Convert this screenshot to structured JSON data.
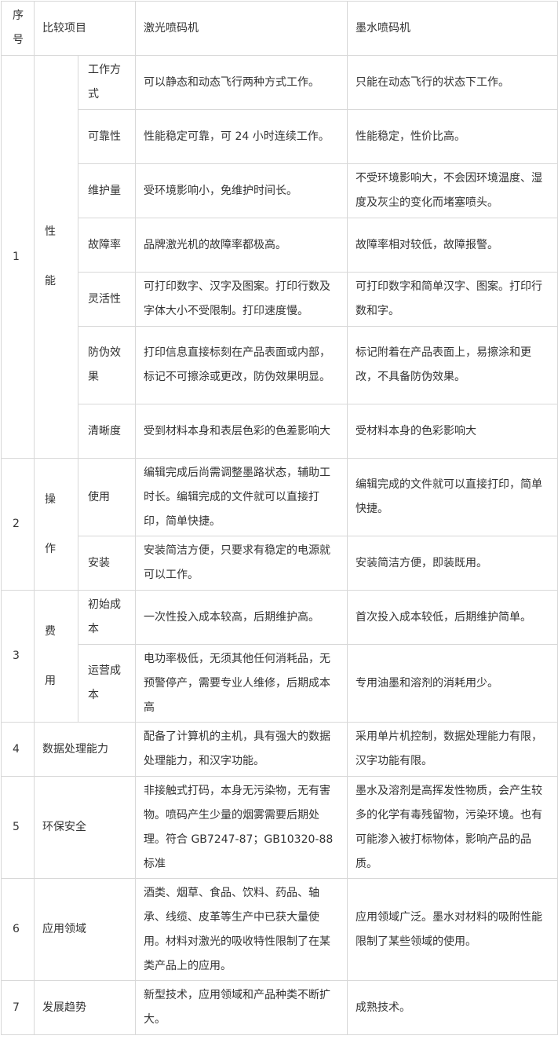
{
  "header": {
    "index": "序号",
    "item": "比较项目",
    "laser": "激光喷码机",
    "ink": "墨水喷码机"
  },
  "groups": {
    "performance": {
      "index": "1",
      "cat_top": "性",
      "cat_bottom": "能"
    },
    "operation": {
      "index": "2",
      "cat_top": "操",
      "cat_bottom": "作"
    },
    "cost": {
      "index": "3",
      "cat_top": "费",
      "cat_bottom": "用"
    }
  },
  "rows": [
    {
      "sub": "工作方式",
      "laser": "可以静态和动态飞行两种方式工作。",
      "ink": "只能在动态飞行的状态下工作。"
    },
    {
      "sub": "可靠性",
      "laser": "性能稳定可靠，可 24 小时连续工作。",
      "ink": "性能稳定，性价比高。"
    },
    {
      "sub": "维护量",
      "laser": "受环境影响小，免维护时间长。",
      "ink": "不受环境影响大，不会因环境温度、湿度及灰尘的变化而堵塞喷头。"
    },
    {
      "sub": "故障率",
      "laser": "品牌激光机的故障率都极高。",
      "ink": "故障率相对较低，故障报警。"
    },
    {
      "sub": "灵活性",
      "laser": "可打印数字、汉字及图案。打印行数及字体大小不受限制。打印速度慢。",
      "ink": "可打印数字和简单汉字、图案。打印行数和字。"
    },
    {
      "sub": "防伪效果",
      "laser": "打印信息直接标刻在产品表面或内部，标记不可擦涂或更改，防伪效果明显。",
      "ink": "标记附着在产品表面上，易擦涂和更改，不具备防伪效果。"
    },
    {
      "sub": "清晰度",
      "laser": "受到材料本身和表层色彩的色差影响大",
      "ink": "受材料本身的色彩影响大"
    },
    {
      "sub": "使用",
      "laser": "编辑完成后尚需调整墨路状态，辅助工时长。编辑完成的文件就可以直接打印，简单快捷。",
      "ink": "编辑完成的文件就可以直接打印，简单快捷。"
    },
    {
      "sub": "安装",
      "laser": "安装简洁方便，只要求有稳定的电源就可以工作。",
      "ink": "安装简洁方便，即装既用。"
    },
    {
      "sub": "初始成本",
      "laser": "一次性投入成本较高，后期维护高。",
      "ink": "首次投入成本较低，后期维护简单。"
    },
    {
      "sub": "运营成本",
      "laser": "电功率极低，无须其他任何消耗品，无预警停产，需要专业人维修，后期成本高",
      "ink": "专用油墨和溶剂的消耗用少。"
    },
    {
      "index": "4",
      "item": "数据处理能力",
      "laser": "配备了计算机的主机，具有强大的数据处理能力，和汉字功能。",
      "ink": "采用单片机控制，数据处理能力有限，汉字功能有限。"
    },
    {
      "index": "5",
      "item": "环保安全",
      "laser": "非接触式打码，本身无污染物，无有害物。喷码产生少量的烟雾需要后期处理。符合 GB7247-87；GB10320-88 标准",
      "ink": "墨水及溶剂是高挥发性物质，会产生较多的化学有毒残留物，污染环境。也有可能渗入被打标物体，影响产品的品质。"
    },
    {
      "index": "6",
      "item": "应用领域",
      "laser": "酒类、烟草、食品、饮料、药品、轴承、线缆、皮革等生产中已获大量使用。材料对激光的吸收特性限制了在某类产品上的应用。",
      "ink": "应用领域广泛。墨水对材料的吸附性能限制了某些领域的使用。"
    },
    {
      "index": "7",
      "item": "发展趋势",
      "laser": "新型技术，应用领域和产品种类不断扩大。",
      "ink": "成熟技术。"
    }
  ]
}
